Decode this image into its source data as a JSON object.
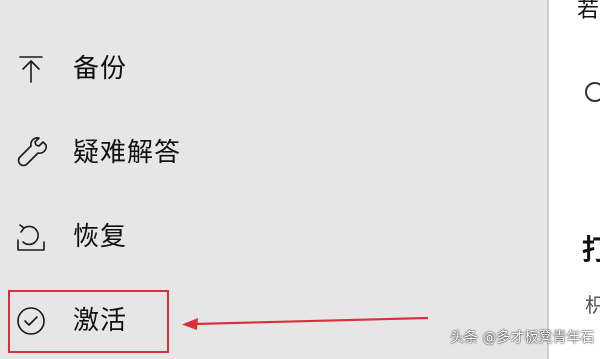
{
  "sidebar": {
    "items": [
      {
        "label": "备份",
        "icon": "backup-arrow-up-icon"
      },
      {
        "label": "疑难解答",
        "icon": "wrench-icon"
      },
      {
        "label": "恢复",
        "icon": "recovery-icon"
      },
      {
        "label": "激活",
        "icon": "checkmark-circle-icon"
      }
    ]
  },
  "right_pane": {
    "top_text": "若",
    "heading": "打",
    "small_text": "枳"
  },
  "annotation": {
    "color": "#d9303a"
  },
  "watermark": {
    "text": "头条 @多才板凳青年石"
  }
}
